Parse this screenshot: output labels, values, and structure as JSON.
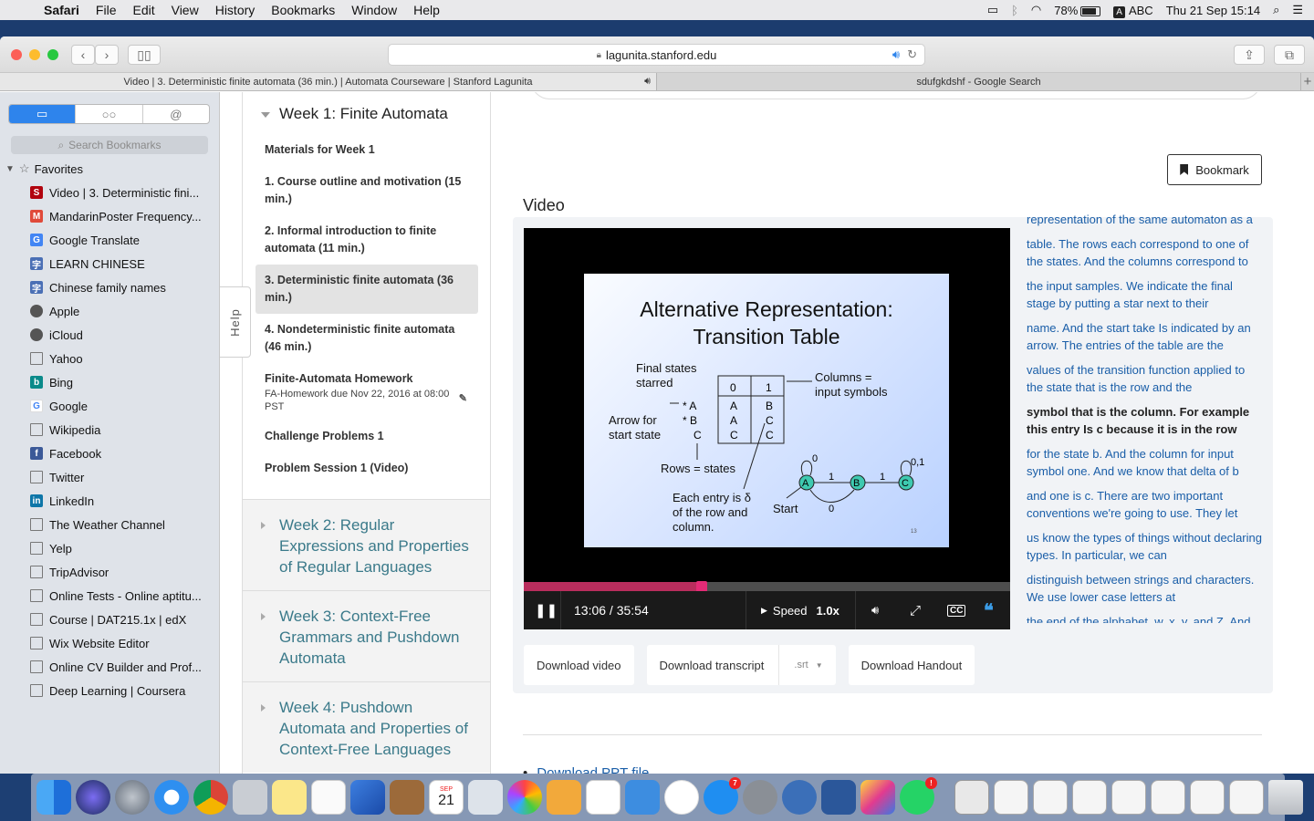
{
  "menubar": {
    "app": "Safari",
    "items": [
      "File",
      "Edit",
      "View",
      "History",
      "Bookmarks",
      "Window",
      "Help"
    ],
    "battery": "78%",
    "input_source": "ABC",
    "input_badge": "A",
    "clock": "Thu 21 Sep  15:14"
  },
  "toolbar": {
    "url": "lagunita.stanford.edu"
  },
  "tabs": [
    {
      "title": "Video | 3. Deterministic finite automata (36 min.) | Automata Courseware | Stanford Lagunita"
    },
    {
      "title": "sdufgkdshf - Google Search"
    }
  ],
  "sidebar": {
    "search_placeholder": "Search Bookmarks",
    "favorites_label": "Favorites",
    "bookmarks": [
      {
        "label": "Video | 3. Deterministic fini...",
        "icon": "stanford-s-icon",
        "color": "#b1040e",
        "glyph": "S"
      },
      {
        "label": "MandarinPoster Frequency...",
        "icon": "mandarin-icon",
        "color": "#e04a3a",
        "glyph": "M"
      },
      {
        "label": "Google Translate",
        "icon": "google-translate-icon",
        "color": "#4285f4",
        "glyph": "G"
      },
      {
        "label": "LEARN CHINESE",
        "icon": "chinese-char-icon",
        "color": "#4a6fb5",
        "glyph": "字"
      },
      {
        "label": "Chinese family names",
        "icon": "chinese-char-icon",
        "color": "#4a6fb5",
        "glyph": "字"
      },
      {
        "label": "Apple",
        "icon": "apple-icon",
        "color": "#555555",
        "glyph": ""
      },
      {
        "label": "iCloud",
        "icon": "apple-icon",
        "color": "#555555",
        "glyph": ""
      },
      {
        "label": "Yahoo",
        "icon": "book-icon",
        "color": "",
        "glyph": ""
      },
      {
        "label": "Bing",
        "icon": "bing-icon",
        "color": "#0a8a8a",
        "glyph": "b"
      },
      {
        "label": "Google",
        "icon": "google-icon",
        "color": "#ffffff",
        "glyph": "G"
      },
      {
        "label": "Wikipedia",
        "icon": "book-icon",
        "color": "",
        "glyph": ""
      },
      {
        "label": "Facebook",
        "icon": "facebook-icon",
        "color": "#3b5998",
        "glyph": "f"
      },
      {
        "label": "Twitter",
        "icon": "book-icon",
        "color": "",
        "glyph": ""
      },
      {
        "label": "LinkedIn",
        "icon": "linkedin-icon",
        "color": "#0e76a8",
        "glyph": "in"
      },
      {
        "label": "The Weather Channel",
        "icon": "book-icon",
        "color": "",
        "glyph": ""
      },
      {
        "label": "Yelp",
        "icon": "book-icon",
        "color": "",
        "glyph": ""
      },
      {
        "label": "TripAdvisor",
        "icon": "book-icon",
        "color": "",
        "glyph": ""
      },
      {
        "label": "Online Tests - Online aptitu...",
        "icon": "book-icon",
        "color": "",
        "glyph": ""
      },
      {
        "label": "Course | DAT215.1x | edX",
        "icon": "book-icon",
        "color": "",
        "glyph": ""
      },
      {
        "label": "Wix Website Editor",
        "icon": "book-icon",
        "color": "",
        "glyph": ""
      },
      {
        "label": "Online CV Builder and Prof...",
        "icon": "book-icon",
        "color": "",
        "glyph": ""
      },
      {
        "label": "Deep Learning | Coursera",
        "icon": "book-icon",
        "color": "",
        "glyph": ""
      }
    ]
  },
  "help_tab": "Help",
  "course_nav": {
    "current_week": "Week 1: Finite Automata",
    "items": [
      {
        "title": "Materials for Week 1",
        "sub": ""
      },
      {
        "title": "1. Course outline and motivation (15 min.)",
        "sub": ""
      },
      {
        "title": "2. Informal introduction to finite automata (11 min.)",
        "sub": ""
      },
      {
        "title": "3. Deterministic finite automata (36 min.)",
        "sub": ""
      },
      {
        "title": "4. Nondeterministic finite automata (46 min.)",
        "sub": ""
      },
      {
        "title": "Finite-Automata Homework",
        "sub": "FA-Homework due Nov 22, 2016 at 08:00 PST"
      },
      {
        "title": "Challenge Problems 1",
        "sub": ""
      },
      {
        "title": "Problem Session 1 (Video)",
        "sub": ""
      }
    ],
    "active_index": 3,
    "other_weeks": [
      "Week 2: Regular Expressions and Properties of Regular Languages",
      "Week 3: Context-Free Grammars and Pushdown Automata",
      "Week 4: Pushdown Automata and Properties of Context-Free Languages"
    ]
  },
  "main": {
    "bookmark_label": "Bookmark",
    "video_heading": "Video",
    "slide": {
      "title_line1": "Alternative Representation:",
      "title_line2": "Transition Table",
      "final_states": "Final states\nstarred",
      "columns_note": "Columns =\ninput symbols",
      "arrow_note": "Arrow for\nstart state",
      "rows_note": "Rows = states",
      "entry_note": "Each entry is δ\nof the row and\ncolumn.",
      "start_label": "Start",
      "page_no": "13",
      "table_header": [
        "0",
        "1"
      ],
      "table_rows": [
        [
          "A",
          "B"
        ],
        [
          "A",
          "C"
        ],
        [
          "C",
          "C"
        ]
      ],
      "row_labels": [
        "* A",
        "* B",
        "C"
      ]
    },
    "player": {
      "time": "13:06 / 35:54",
      "progress": 0.365,
      "speed_label": "Speed",
      "speed_value": "1.0x"
    },
    "transcript": [
      "representation of the same automaton as a",
      "table. The rows each correspond to one of the states. And the columns correspond to",
      "the input samples. We indicate the final stage by putting a star next to their",
      "name. And the start take Is indicated by an arrow. The entries of the table are the",
      "values of the transition function applied to the state that is the row and the",
      "symbol that is the column. For example this entry Is c because it is in the row",
      "for the state b. And the column for input symbol one. And we know that delta of b",
      "and one is c. There are two important conventions we're going to use. They let",
      "us know the types of things without declaring types. In particular, we can",
      "distinguish between strings and characters. We use lower case letters at",
      "the end of the alphabet, w, x, y, and Z. And"
    ],
    "transcript_current": 5,
    "downloads": {
      "video": "Download video",
      "transcript": "Download transcript",
      "format": ".srt",
      "handout": "Download Handout"
    },
    "ppt_link": "Download PPT file"
  },
  "dock": {
    "calendar_day": "21",
    "calendar_month": "SEP",
    "appstore_badge": "7",
    "whatsapp_badge": "!"
  }
}
